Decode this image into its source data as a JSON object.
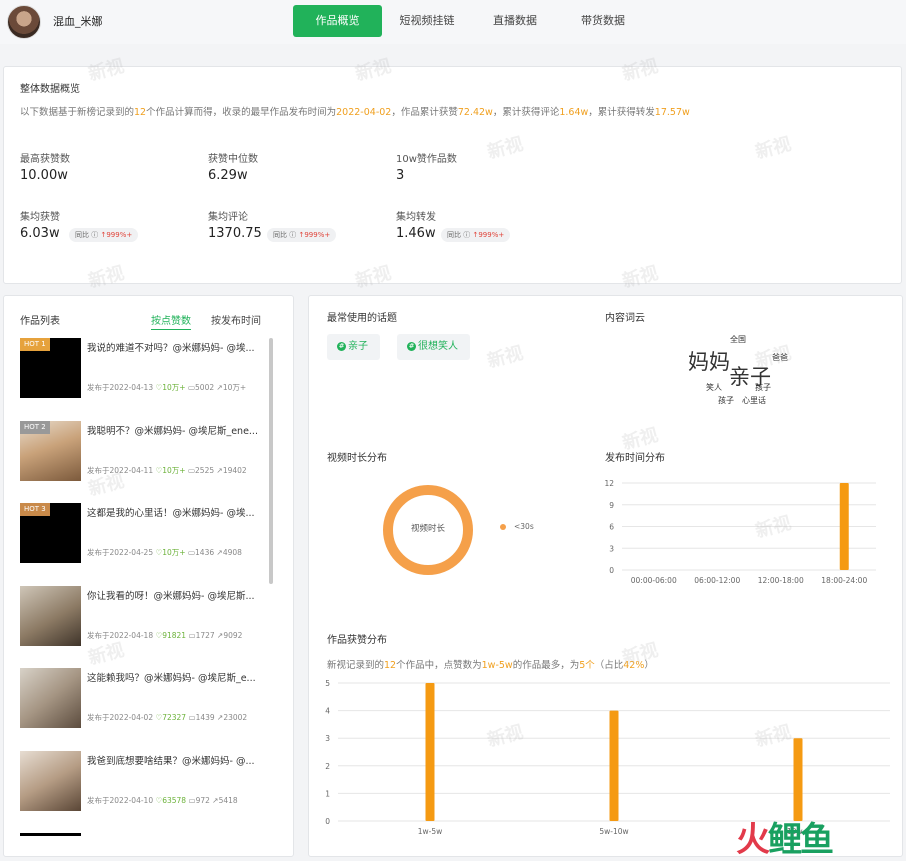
{
  "header": {
    "username": "混血_米娜",
    "tabs": [
      "作品概览",
      "短视频挂链",
      "直播数据",
      "带货数据"
    ]
  },
  "overview": {
    "title": "整体数据概览",
    "desc": {
      "p1": "以下数据基于新榜记录到的",
      "count": "12",
      "p2": "个作品计算而得，收录的最早作品发布时间为",
      "date": "2022-04-02",
      "p3": "，作品累计获赞",
      "likes": "72.42w",
      "p4": "，累计获得评论",
      "comments": "1.64w",
      "p5": "，累计获得转发",
      "shares": "17.57w"
    },
    "stats": [
      {
        "label": "最高获赞数",
        "value": "10.00w"
      },
      {
        "label": "获赞中位数",
        "value": "6.29w"
      },
      {
        "label": "10w赞作品数",
        "value": "3"
      },
      {
        "label": "集均获赞",
        "value": "6.03w",
        "yoy_label": "同比",
        "yoy_value": "999%+"
      },
      {
        "label": "集均评论",
        "value": "1370.75",
        "yoy_label": "同比",
        "yoy_value": "999%+"
      },
      {
        "label": "集均转发",
        "value": "1.46w",
        "yoy_label": "同比",
        "yoy_value": "999%+"
      }
    ]
  },
  "works": {
    "title": "作品列表",
    "sort_options": [
      "按点赞数",
      "按发布时间"
    ],
    "items": [
      {
        "hot": "HOT 1",
        "title": "我说的难道不对吗？@米娜妈妈- @埃...",
        "date": "发布于2022-04-13",
        "likes": "10万+",
        "comments": "5002",
        "shares": "10万+"
      },
      {
        "hot": "HOT 2",
        "title": "我聪明不？@米娜妈妈- @埃尼斯_ene...",
        "date": "发布于2022-04-11",
        "likes": "10万+",
        "comments": "2525",
        "shares": "19402"
      },
      {
        "hot": "HOT 3",
        "title": "这都是我的心里话！@米娜妈妈- @埃...",
        "date": "发布于2022-04-25",
        "likes": "10万+",
        "comments": "1436",
        "shares": "4908"
      },
      {
        "hot": "",
        "title": "你让我看的呀！@米娜妈妈- @埃尼斯...",
        "date": "发布于2022-04-18",
        "likes": "91821",
        "comments": "1727",
        "shares": "9092"
      },
      {
        "hot": "",
        "title": "这能赖我吗？@米娜妈妈- @埃尼斯_e...",
        "date": "发布于2022-04-02",
        "likes": "72327",
        "comments": "1439",
        "shares": "23002"
      },
      {
        "hot": "",
        "title": "我爸到底想要啥结果？@米娜妈妈- @...",
        "date": "发布于2022-04-10",
        "likes": "63578",
        "comments": "972",
        "shares": "5418"
      }
    ]
  },
  "topics": {
    "title": "最常使用的话题",
    "items": [
      "亲子",
      "很想笑人"
    ]
  },
  "wordcloud": {
    "title": "内容词云",
    "words": [
      {
        "text": "全国",
        "color": "#8fcf9c"
      },
      {
        "text": "妈妈",
        "color": "#3a9a4a"
      },
      {
        "text": "亲子",
        "color": "#2f8f3c"
      },
      {
        "text": "爸爸",
        "color": "#a6d8b0"
      },
      {
        "text": "笑人",
        "color": "#a6d8b0"
      },
      {
        "text": "孩子",
        "color": "#a6d8b0"
      },
      {
        "text": "孩子",
        "color": "#a6d8b0"
      },
      {
        "text": "心里话",
        "color": "#a6d8b0"
      }
    ]
  },
  "duration": {
    "title": "视频时长分布",
    "center_label": "视频时长",
    "legend": "<30s",
    "color": "#f5a04a"
  },
  "publish_time": {
    "title": "发布时间分布",
    "chart_data": {
      "type": "bar",
      "categories": [
        "00:00-06:00",
        "06:00-12:00",
        "12:00-18:00",
        "18:00-24:00"
      ],
      "values": [
        0,
        0,
        0,
        12
      ],
      "ylim": [
        0,
        12
      ],
      "yticks": [
        "0",
        "3",
        "6",
        "9",
        "12"
      ],
      "color": "#f59a12"
    }
  },
  "likes_dist": {
    "title": "作品获赞分布",
    "desc": {
      "p1": "新视记录到的",
      "count": "12",
      "p2": "个作品中，点赞数为",
      "range": "1w-5w",
      "p3": "的作品最多，为",
      "num": "5个",
      "p4": "（占比",
      "pct": "42%",
      "p5": "）"
    },
    "chart_data": {
      "type": "bar",
      "categories": [
        "1w-5w",
        "5w-10w",
        "10w+"
      ],
      "values": [
        5,
        4,
        3
      ],
      "ylim": [
        0,
        5
      ],
      "yticks": [
        "0",
        "1",
        "2",
        "3",
        "4",
        "5"
      ],
      "color": "#f59a12"
    }
  },
  "watermark": "新视",
  "brand": {
    "part1": "火",
    "part2": "鲤鱼"
  }
}
